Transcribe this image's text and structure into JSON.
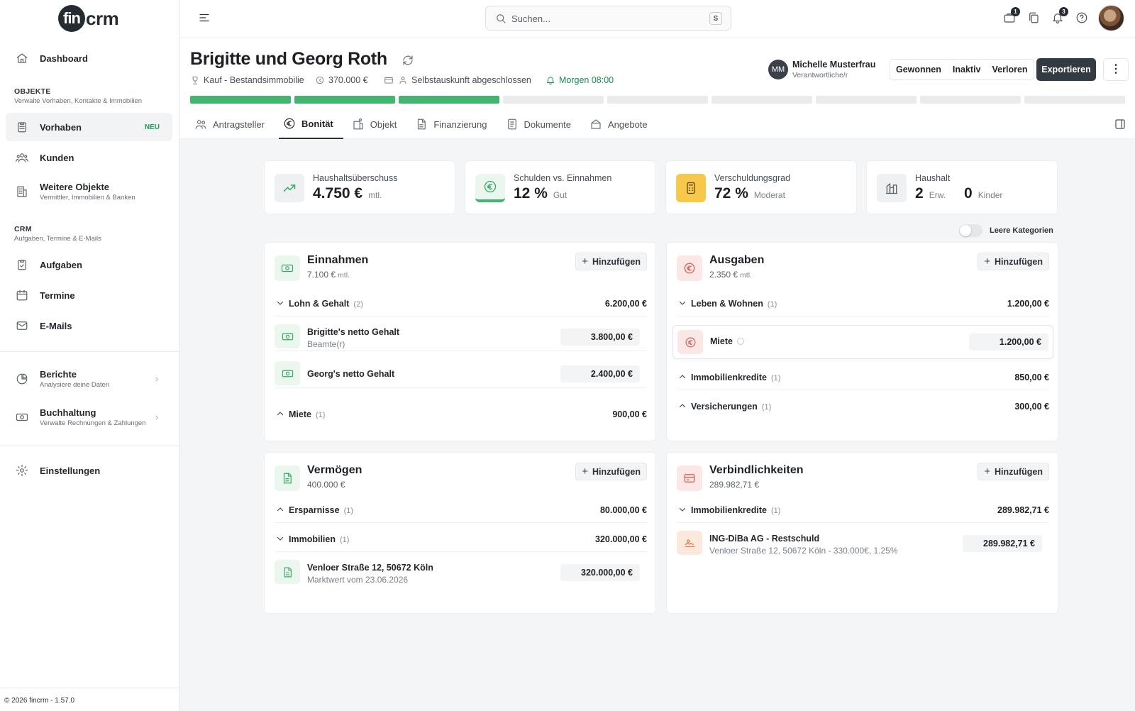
{
  "brand": {
    "logo_left": "fin",
    "logo_right": "crm"
  },
  "sidebar": {
    "dashboard": "Dashboard",
    "section_objects": {
      "title": "OBJEKTE",
      "subtitle": "Verwalte Vorhaben, Kontakte & Immobilien"
    },
    "vorhaben": {
      "label": "Vorhaben",
      "badge": "NEU"
    },
    "kunden": "Kunden",
    "weitere": {
      "label": "Weitere Objekte",
      "sub": "Vermittler, Immobilien & Banken"
    },
    "section_crm": {
      "title": "CRM",
      "subtitle": "Aufgaben, Termine & E-Mails"
    },
    "aufgaben": "Aufgaben",
    "termine": "Termine",
    "emails": "E-Mails",
    "berichte": {
      "label": "Berichte",
      "sub": "Analysiere deine Daten"
    },
    "buchhaltung": {
      "label": "Buchhaltung",
      "sub": "Verwalte Rechnungen & Zahlungen"
    },
    "einstellungen": "Einstellungen",
    "copyright": "© 2026 fincrm - 1.57.0"
  },
  "topbar": {
    "search_placeholder": "Suchen...",
    "search_shortcut": "S",
    "badges": {
      "inbox": "1",
      "notifications": "3"
    }
  },
  "header": {
    "title": "Brigitte und Georg Roth",
    "meta": {
      "type": "Kauf - Bestandsimmobilie",
      "amount": "370.000 €",
      "status": "Selbstauskunft abgeschlossen",
      "reminder": "Morgen 08:00"
    },
    "progress": {
      "done": 3,
      "total": 9
    },
    "owner": {
      "initials": "MM",
      "name": "Michelle Musterfrau",
      "role": "Verantwortliche/r"
    },
    "status_buttons": [
      "Gewonnen",
      "Inaktiv",
      "Verloren"
    ],
    "export": "Exportieren",
    "more": "⋮",
    "tabs": [
      "Antragsteller",
      "Bonität",
      "Objekt",
      "Finanzierung",
      "Dokumente",
      "Angebote"
    ],
    "active_tab": "Bonität"
  },
  "stats": [
    {
      "label": "Haushaltsüberschuss",
      "value": "4.750 €",
      "note": "mtl."
    },
    {
      "label": "Schulden vs. Einnahmen",
      "value": "12 %",
      "note": "Gut"
    },
    {
      "label": "Verschuldungsgrad",
      "value": "72 %",
      "note": "Moderat"
    },
    {
      "label": "Haushalt",
      "adults": "2",
      "adults_label": "Erw.",
      "kids": "0",
      "kids_label": "Kinder"
    }
  ],
  "toggle_label": "Leere Kategorien",
  "add_label": "Hinzufügen",
  "einnahmen": {
    "title": "Einnahmen",
    "total": "7.100 €",
    "unit": "mtl.",
    "cat1": {
      "name": "Lohn & Gehalt",
      "count": "(2)",
      "amount": "6.200,00 €"
    },
    "items": [
      {
        "name": "Brigitte's netto Gehalt",
        "sub": "Beamte(r)",
        "value": "3.800,00 €"
      },
      {
        "name": "Georg's netto Gehalt",
        "value": "2.400,00 €"
      }
    ],
    "cat2": {
      "name": "Miete",
      "count": "(1)",
      "amount": "900,00 €"
    }
  },
  "ausgaben": {
    "title": "Ausgaben",
    "total": "2.350 €",
    "unit": "mtl.",
    "cat1": {
      "name": "Leben & Wohnen",
      "count": "(1)",
      "amount": "1.200,00 €"
    },
    "item": {
      "name": "Miete",
      "value": "1.200,00 €"
    },
    "cat2": {
      "name": "Immobilienkredite",
      "count": "(1)",
      "amount": "850,00 €"
    },
    "cat3": {
      "name": "Versicherungen",
      "count": "(1)",
      "amount": "300,00 €"
    }
  },
  "vermoegen": {
    "title": "Vermögen",
    "total": "400.000 €",
    "cat1": {
      "name": "Ersparnisse",
      "count": "(1)",
      "amount": "80.000,00 €"
    },
    "cat2": {
      "name": "Immobilien",
      "count": "(1)",
      "amount": "320.000,00 €"
    },
    "item": {
      "name": "Venloer Straße 12, 50672 Köln",
      "sub": "Marktwert vom 23.06.2026",
      "value": "320.000,00 €"
    }
  },
  "verbindlichkeiten": {
    "title": "Verbindlichkeiten",
    "total": "289.982,71 €",
    "cat1": {
      "name": "Immobilienkredite",
      "count": "(1)",
      "amount": "289.982,71 €"
    },
    "item": {
      "name": "ING-DiBa AG - Restschuld",
      "sub": "Venloer Straße 12, 50672 Köln - 330.000€, 1.25%",
      "value": "289.982,71 €"
    }
  }
}
